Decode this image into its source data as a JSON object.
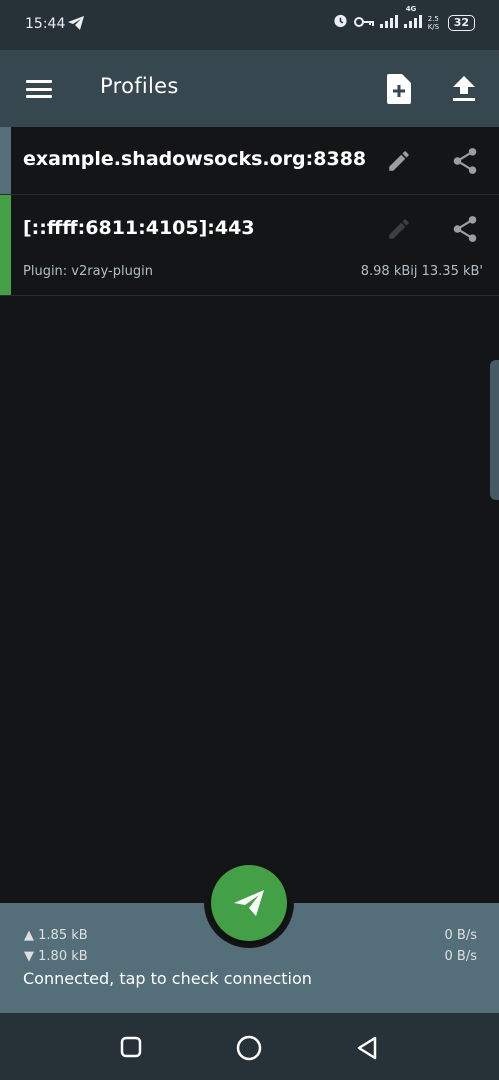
{
  "status_bar": {
    "time": "15:44",
    "network": "4G",
    "speed": "2.5 K/S",
    "battery": "32"
  },
  "app_bar": {
    "title": "Profiles",
    "icons": [
      "menu-icon",
      "add-profile-icon",
      "import-icon"
    ]
  },
  "profiles": [
    {
      "name": "example.shadowsocks.org:8388",
      "indicator_color": "#546e7a",
      "icons": [
        "edit-icon",
        "share-icon"
      ]
    },
    {
      "name": "[::ffff:6811:4105]:443",
      "plugin": "Plugin: v2ray-plugin",
      "traffic": "8.98 kBij 13.35 kB'",
      "indicator_color": "#43a047",
      "icons": [
        "edit-icon",
        "share-icon"
      ]
    }
  ],
  "stats": {
    "tx_total": "1.85 kB",
    "rx_total": "1.80 kB",
    "tx_rate": "0 B/s",
    "rx_rate": "0 B/s",
    "status": "Connected, tap to check connection"
  },
  "colors": {
    "app_bar": "#37474f",
    "status_bar": "#263238",
    "bottom_panel": "#546e7a",
    "fab": "#43a047",
    "background": "#141516"
  }
}
